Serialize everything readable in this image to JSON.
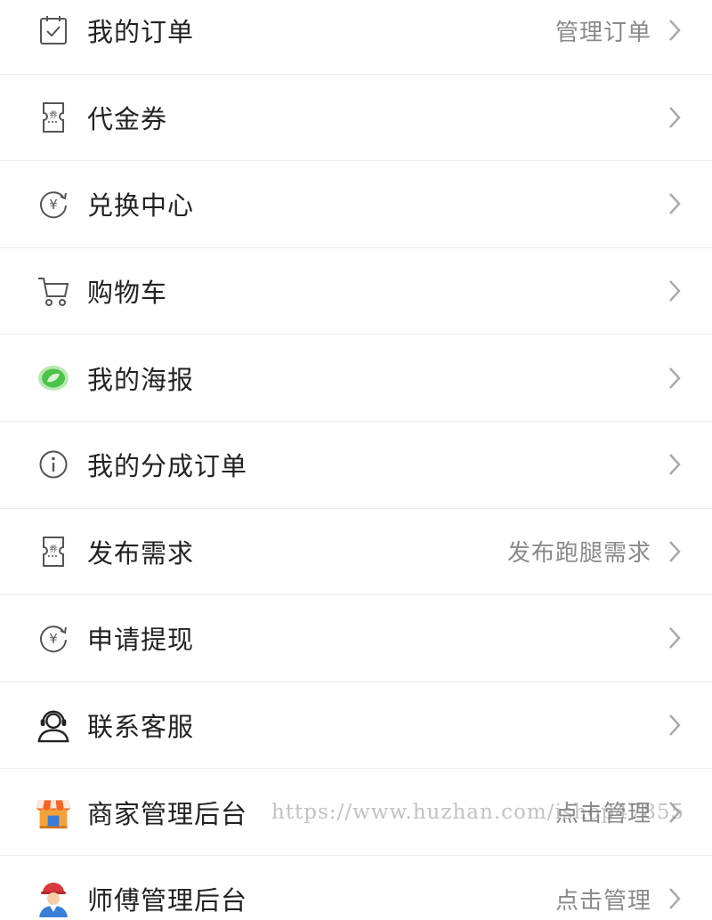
{
  "menu": {
    "items": [
      {
        "label": "我的订单",
        "right": "管理订单"
      },
      {
        "label": "代金券",
        "right": ""
      },
      {
        "label": "兑换中心",
        "right": ""
      },
      {
        "label": "购物车",
        "right": ""
      },
      {
        "label": "我的海报",
        "right": ""
      },
      {
        "label": "我的分成订单",
        "right": ""
      },
      {
        "label": "发布需求",
        "right": "发布跑腿需求"
      },
      {
        "label": "申请提现",
        "right": ""
      },
      {
        "label": "联系客服",
        "right": ""
      },
      {
        "label": "商家管理后台",
        "right": "点击管理"
      },
      {
        "label": "师傅管理后台",
        "right": "点击管理"
      }
    ]
  },
  "watermark": "https://www.huzhan.com/ishop47855",
  "colors": {
    "accent_green": "#4cc24a",
    "text": "#222222",
    "secondary": "#8a8a8a"
  }
}
